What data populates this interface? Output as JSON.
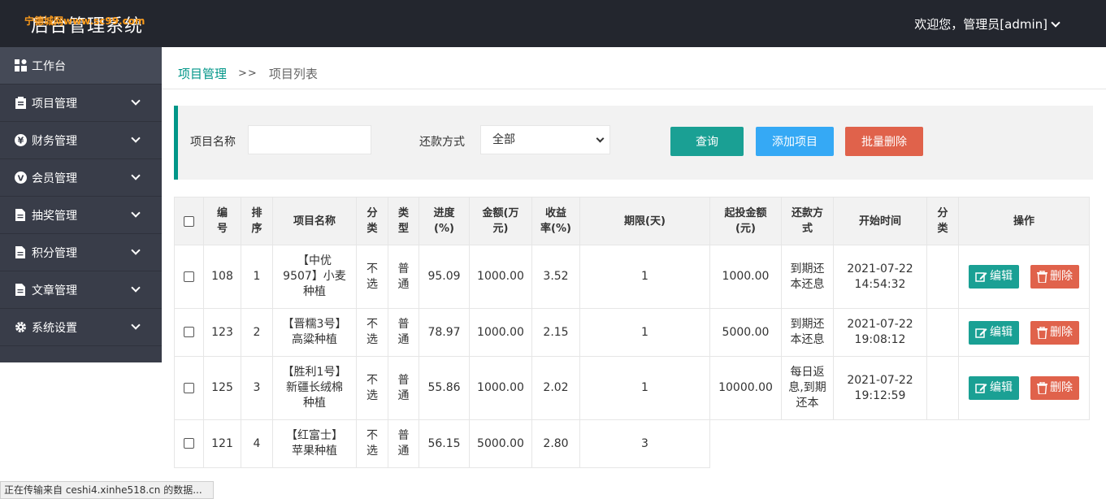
{
  "header": {
    "brand": "后台管理系统",
    "watermark": "宁德城网www.sc99.com",
    "welcome": "欢迎您，管理员[admin]"
  },
  "sidebar": {
    "items": [
      {
        "label": "工作台",
        "icon": "dashboard-icon",
        "expandable": false
      },
      {
        "label": "项目管理",
        "icon": "clipboard-icon",
        "expandable": true
      },
      {
        "label": "财务管理",
        "icon": "yen-icon",
        "expandable": true
      },
      {
        "label": "会员管理",
        "icon": "member-v-icon",
        "expandable": true
      },
      {
        "label": "抽奖管理",
        "icon": "document-icon",
        "expandable": true
      },
      {
        "label": "积分管理",
        "icon": "document-icon",
        "expandable": true
      },
      {
        "label": "文章管理",
        "icon": "document-icon",
        "expandable": true
      },
      {
        "label": "系统设置",
        "icon": "gear-icon",
        "expandable": true
      }
    ]
  },
  "breadcrumb": {
    "parent": "项目管理",
    "separator": ">>",
    "current": "项目列表"
  },
  "search": {
    "name_label": "项目名称",
    "name_value": "",
    "repay_label": "还款方式",
    "repay_value": "全部",
    "query_btn": "查询",
    "add_btn": "添加项目",
    "batch_delete_btn": "批量删除"
  },
  "table": {
    "headers": [
      "编\n号",
      "排\n序",
      "项目名称",
      "分\n类",
      "类\n型",
      "进度\n(%)",
      "金额(万\n元)",
      "收益\n率(%)",
      "期限(天)",
      "起投金额\n(元)",
      "还款方\n式",
      "开始时间",
      "分\n类",
      "操作"
    ],
    "rows": [
      {
        "id": "108",
        "sort": "1",
        "name": "【中优9507】小麦种植",
        "cat": "不选",
        "type": "普通",
        "progress": "95.09",
        "amount": "1000.00",
        "rate": "3.52",
        "days": "1",
        "min": "1000.00",
        "repay": "到期还本还息",
        "start": "2021-07-22 14:54:32",
        "cat2": ""
      },
      {
        "id": "123",
        "sort": "2",
        "name": "【晋糯3号】高粱种植",
        "cat": "不选",
        "type": "普通",
        "progress": "78.97",
        "amount": "1000.00",
        "rate": "2.15",
        "days": "1",
        "min": "5000.00",
        "repay": "到期还本还息",
        "start": "2021-07-22 19:08:12",
        "cat2": ""
      },
      {
        "id": "125",
        "sort": "3",
        "name": "【胜利1号】新疆长绒棉种植",
        "cat": "不选",
        "type": "普通",
        "progress": "55.86",
        "amount": "1000.00",
        "rate": "2.02",
        "days": "1",
        "min": "10000.00",
        "repay": "每日返息,到期还本",
        "start": "2021-07-22 19:12:59",
        "cat2": ""
      },
      {
        "id": "121",
        "sort": "4",
        "name": "【红富士】苹果种植",
        "cat": "不选",
        "type": "普通",
        "progress": "56.15",
        "amount": "5000.00",
        "rate": "2.80",
        "days": "3",
        "min": "",
        "repay": "",
        "start": "",
        "cat2": ""
      }
    ],
    "edit_label": "编辑",
    "delete_label": "删除"
  },
  "status_bar": "正在传输来自 ceshi4.xinhe518.cn 的数据...",
  "colors": {
    "topbar": "#23262e",
    "sidebar": "#393d49",
    "accent": "#009688",
    "add": "#35a9f5",
    "danger": "#e0624b"
  }
}
